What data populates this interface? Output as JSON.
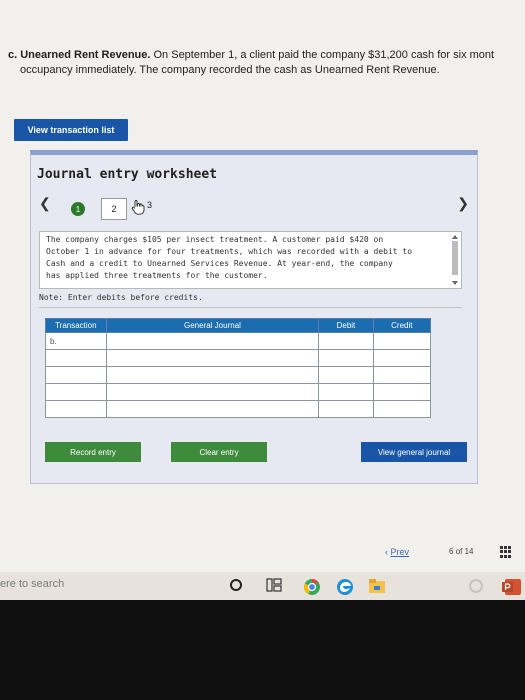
{
  "question": {
    "label": "c. Unearned Rent Revenue.",
    "line1_rest": "On September 1, a client paid the company $31,200 cash for six mont",
    "line2": "occupancy immediately. The company recorded the cash as Unearned Rent Revenue."
  },
  "buttons": {
    "view_transactions": "View transaction list",
    "record_entry": "Record entry",
    "clear_entry": "Clear entry",
    "view_journal": "View general journal"
  },
  "worksheet": {
    "title": "Journal entry worksheet",
    "steps": [
      "1",
      "2",
      "3"
    ],
    "description": [
      "The company charges $105 per insect treatment. A customer paid $420 on",
      "October 1 in advance for four treatments, which was recorded with a debit to",
      "Cash and a credit to Unearned Services Revenue. At year-end, the company",
      "has applied three treatments for the customer."
    ],
    "note": "Note: Enter debits before credits."
  },
  "table": {
    "headers": [
      "Transaction",
      "General Journal",
      "Debit",
      "Credit"
    ],
    "rows": [
      [
        "b.",
        "",
        "",
        ""
      ],
      [
        "",
        "",
        "",
        ""
      ],
      [
        "",
        "",
        "",
        ""
      ],
      [
        "",
        "",
        "",
        ""
      ],
      [
        "",
        "",
        "",
        ""
      ]
    ]
  },
  "pagination": {
    "prev": "Prev",
    "current": "6",
    "of_label": "of",
    "total": "14"
  },
  "taskbar": {
    "search_placeholder": "ere to search"
  }
}
